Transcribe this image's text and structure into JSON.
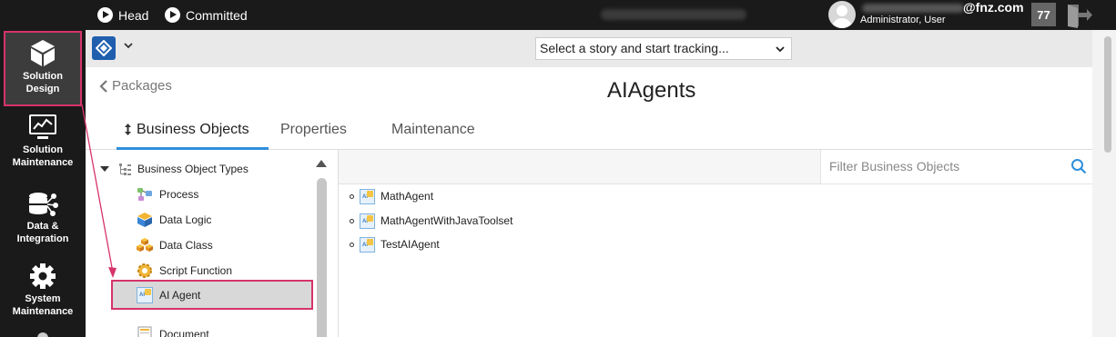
{
  "topbar": {
    "head_label": "Head",
    "committed_label": "Committed",
    "user_email_domain": "@fnz.com",
    "user_role": "Administrator, User",
    "notification_count": "77"
  },
  "leftnav": {
    "items": [
      {
        "label_line1": "Solution",
        "label_line2": "Design",
        "icon": "cube-icon",
        "active": true
      },
      {
        "label_line1": "Solution",
        "label_line2": "Maintenance",
        "icon": "monitor-chart-icon"
      },
      {
        "label_line1": "Data &",
        "label_line2": "Integration",
        "icon": "database-network-icon"
      },
      {
        "label_line1": "System",
        "label_line2": "Maintenance",
        "icon": "gear-icon"
      }
    ]
  },
  "toolbar": {
    "story_select_value": "Select a story and start tracking..."
  },
  "header": {
    "back_label": "Packages",
    "title": "AIAgents"
  },
  "tabs": [
    {
      "label": "Business Objects",
      "active": true
    },
    {
      "label": "Properties"
    },
    {
      "label": "Maintenance"
    }
  ],
  "tree": {
    "root_label": "Business Object Types",
    "nodes": [
      {
        "label": "Process",
        "icon": "process-icon"
      },
      {
        "label": "Data Logic",
        "icon": "data-logic-icon"
      },
      {
        "label": "Data Class",
        "icon": "data-class-icon"
      },
      {
        "label": "Script Function",
        "icon": "script-function-icon"
      },
      {
        "label": "AI Agent",
        "icon": "ai-agent-icon",
        "selected": true
      },
      {
        "label": "Document",
        "icon": "document-icon"
      }
    ]
  },
  "objects": {
    "filter_placeholder": "Filter Business Objects",
    "rows": [
      {
        "label": "MathAgent"
      },
      {
        "label": "MathAgentWithJavaToolset"
      },
      {
        "label": "TestAIAgent"
      }
    ]
  },
  "colors": {
    "highlight": "#d6336c",
    "active_tab": "#2f8fdb",
    "brand": "#1f5fad"
  }
}
